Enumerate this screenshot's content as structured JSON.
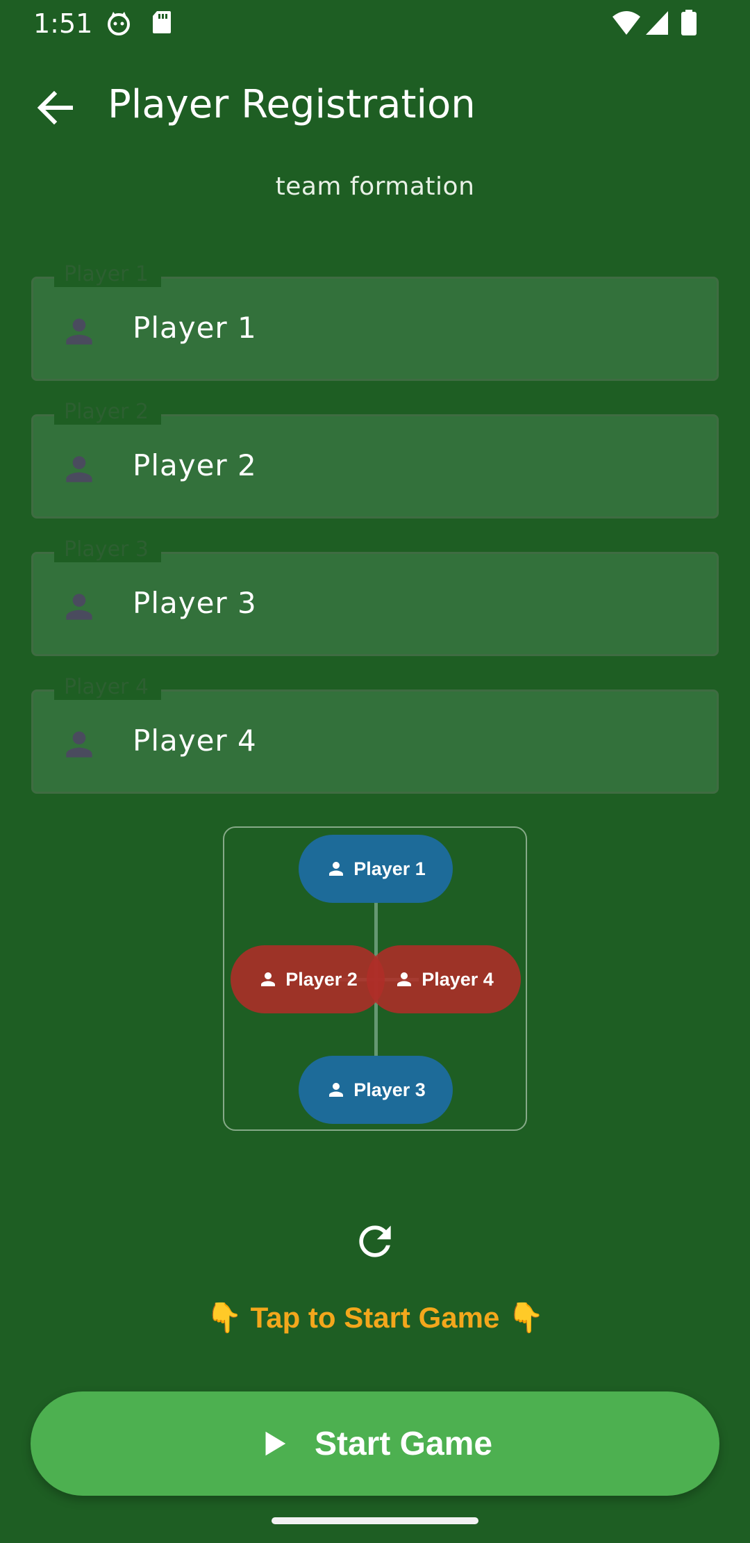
{
  "status_bar": {
    "time": "1:51",
    "icons": [
      "cat-notification-icon",
      "sd-card-icon",
      "wifi-icon",
      "cell-signal-icon",
      "battery-icon"
    ]
  },
  "app_bar": {
    "title": "Player Registration",
    "back_icon": "arrow-back-icon"
  },
  "subtitle": "team formation",
  "players": [
    {
      "label": "Player 1",
      "value": "Player 1"
    },
    {
      "label": "Player 2",
      "value": "Player 2"
    },
    {
      "label": "Player 3",
      "value": "Player 3"
    },
    {
      "label": "Player 4",
      "value": "Player 4"
    }
  ],
  "formation": {
    "top": "Player 1",
    "left": "Player 2",
    "right": "Player 4",
    "bottom": "Player 3",
    "team_colors": {
      "blue": "#1d6b99",
      "red": "#af2e28"
    }
  },
  "hint": "👇 Tap to Start Game 👇",
  "start_button": {
    "label": "Start Game",
    "icon": "play-icon"
  },
  "colors": {
    "background": "#1e5e23",
    "field": "#33713b",
    "accent": "#4db050",
    "hint": "#f3a71c"
  }
}
